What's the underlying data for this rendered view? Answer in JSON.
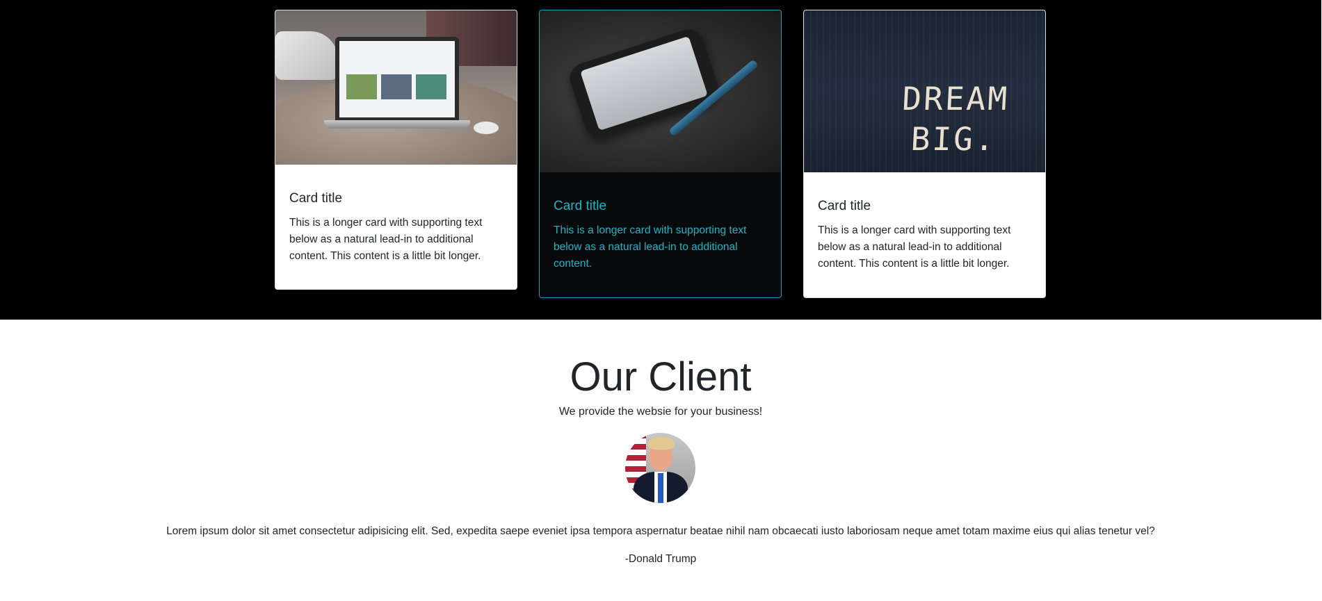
{
  "cards": [
    {
      "title": "Card title",
      "text": "This is a longer card with supporting text below as a natural lead-in to additional content. This content is a little bit longer.",
      "image_icon": "laptop-photo"
    },
    {
      "title": "Card title",
      "text": "This is a longer card with supporting text below as a natural lead-in to additional content.",
      "image_icon": "phone-and-pen-photo"
    },
    {
      "title": "Card title",
      "text": "This is a longer card with supporting text below as a natural lead-in to additional content. This content is a little bit longer.",
      "image_icon": "dream-big-photo",
      "image_text": "DREAM BIG."
    }
  ],
  "client": {
    "heading": "Our Client",
    "subheading": "We provide the websie for your business!",
    "quote": "Lorem ipsum dolor sit amet consectetur adipisicing elit. Sed, expedita saepe eveniet ipsa tempora aspernatur beatae nihil nam obcaecati iusto laboriosam neque amet totam maxime eius qui alias tenetur vel?",
    "author": "-Donald Trump"
  },
  "colors": {
    "band_background": "#000000",
    "accent": "#17a2b8",
    "card_background": "#ffffff",
    "text": "#212529"
  }
}
